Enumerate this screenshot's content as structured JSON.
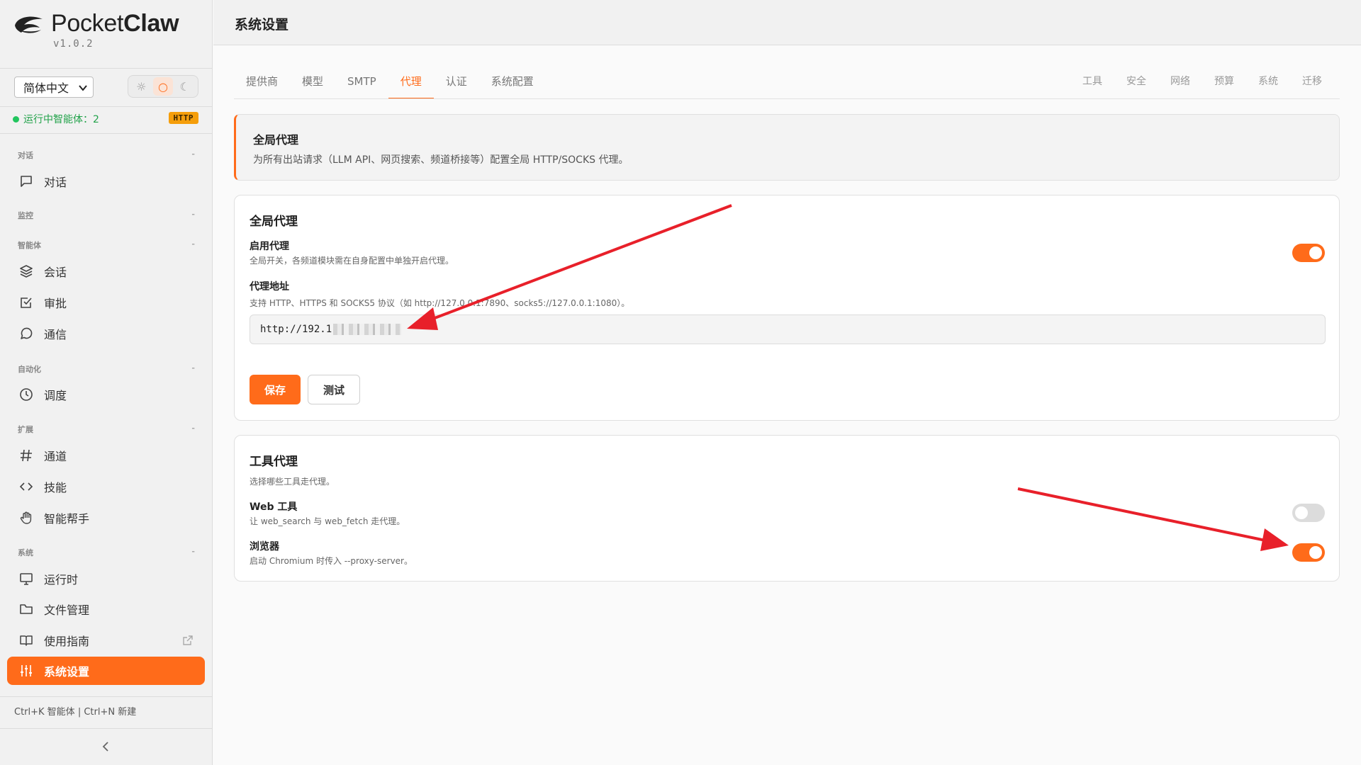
{
  "app": {
    "name_light": "Pocket",
    "name_bold": "Claw",
    "version": "v1.0.2"
  },
  "sidebar": {
    "language": "简体中文",
    "theme": {
      "light_icon": "sun-icon",
      "system_icon": "circle-icon",
      "dark_icon": "moon-icon",
      "active": "system"
    },
    "status_text": "运行中智能体：2",
    "status_badge": "HTTP",
    "sections": [
      {
        "title": "对话",
        "items": [
          {
            "label": "对话",
            "icon": "chat-icon"
          }
        ]
      },
      {
        "title": "监控",
        "items": []
      },
      {
        "title": "智能体",
        "items": [
          {
            "label": "会话",
            "icon": "layers-icon"
          },
          {
            "label": "审批",
            "icon": "checkbox-icon"
          },
          {
            "label": "通信",
            "icon": "message-circle-icon"
          }
        ]
      },
      {
        "title": "自动化",
        "items": [
          {
            "label": "调度",
            "icon": "clock-icon"
          }
        ]
      },
      {
        "title": "扩展",
        "items": [
          {
            "label": "通道",
            "icon": "hash-icon"
          },
          {
            "label": "技能",
            "icon": "code-icon"
          },
          {
            "label": "智能帮手",
            "icon": "hand-icon"
          }
        ]
      },
      {
        "title": "系统",
        "items": [
          {
            "label": "运行时",
            "icon": "monitor-icon"
          },
          {
            "label": "文件管理",
            "icon": "folder-icon"
          },
          {
            "label": "使用指南",
            "icon": "book-icon"
          },
          {
            "label": "系统设置",
            "icon": "sliders-icon",
            "active": true
          }
        ]
      }
    ],
    "shortcut_hint": "Ctrl+K 智能体 | Ctrl+N 新建"
  },
  "header": {
    "title": "系统设置"
  },
  "tabs_left": [
    "提供商",
    "模型",
    "SMTP",
    "代理",
    "认证",
    "系统配置"
  ],
  "active_tab": "代理",
  "tabs_right": [
    "工具",
    "安全",
    "网络",
    "预算",
    "系统",
    "迁移"
  ],
  "info": {
    "title": "全局代理",
    "desc": "为所有出站请求（LLM API、网页搜索、频道桥接等）配置全局 HTTP/SOCKS 代理。"
  },
  "global_proxy": {
    "title": "全局代理",
    "enable_label": "启用代理",
    "enable_desc": "全局开关，各频道模块需在自身配置中单独开启代理。",
    "enabled": true,
    "address_label": "代理地址",
    "address_desc": "支持 HTTP、HTTPS 和 SOCKS5 协议（如 http://127.0.0.1:7890、socks5://127.0.0.1:1080）。",
    "address_value": "http://192.1",
    "save_label": "保存",
    "test_label": "测试"
  },
  "tool_proxy": {
    "title": "工具代理",
    "desc": "选择哪些工具走代理。",
    "items": [
      {
        "label": "Web 工具",
        "desc": "让 web_search 与 web_fetch 走代理。",
        "enabled": false
      },
      {
        "label": "浏览器",
        "desc": "启动 Chromium 时传入 --proxy-server。",
        "enabled": true
      }
    ]
  },
  "colors": {
    "accent": "#ff6b1a",
    "status": "#22c55e",
    "badge": "#f59e0b",
    "annotation": "#e8202a"
  }
}
